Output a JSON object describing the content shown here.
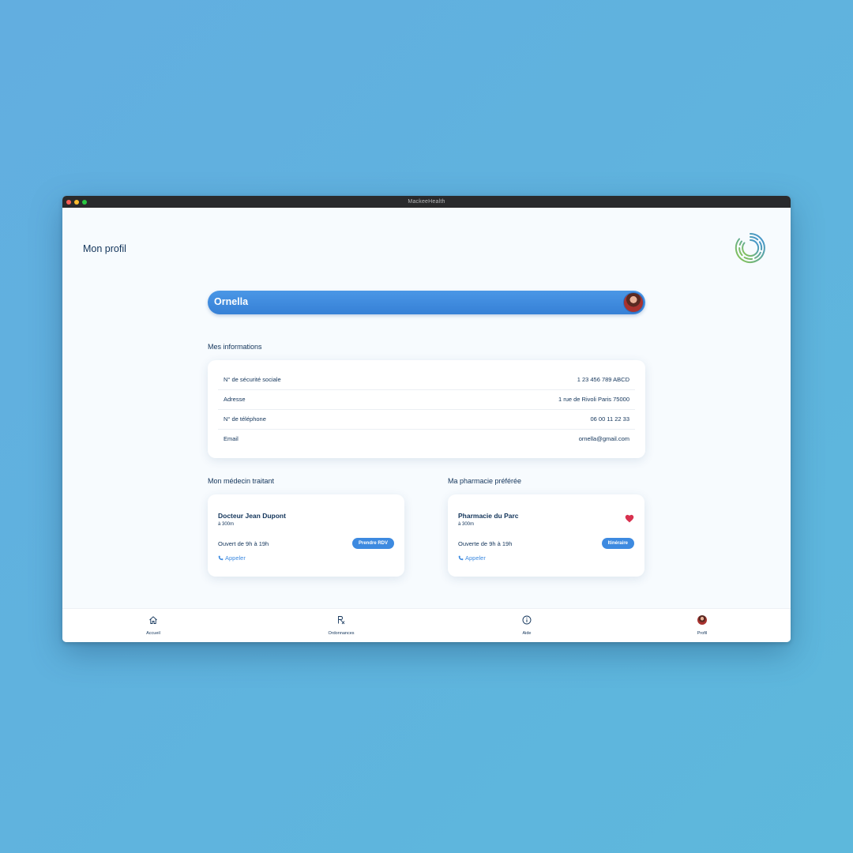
{
  "window": {
    "title": "MackeeHealth"
  },
  "page": {
    "title": "Mon profil"
  },
  "user": {
    "name": "Ornella"
  },
  "info": {
    "heading": "Mes informations",
    "rows": [
      {
        "label": "N° de sécurité sociale",
        "value": "1 23 456 789 ABCD"
      },
      {
        "label": "Adresse",
        "value": "1 rue de Rivoli Paris 75000"
      },
      {
        "label": "N° de téléphone",
        "value": "06 00 11 22 33"
      },
      {
        "label": "Email",
        "value": "ornella@gmail.com"
      }
    ]
  },
  "doctor": {
    "heading": "Mon médecin traitant",
    "name": "Docteur Jean Dupont",
    "distance": "à 300m",
    "hours": "Ouvert de 9h à 19h",
    "button": "Prendre RDV",
    "call": "Appeler"
  },
  "pharmacy": {
    "heading": "Ma pharmacie préférée",
    "name": "Pharmacie du Parc",
    "distance": "à 300m",
    "hours": "Ouverte de 9h à 19h",
    "button": "Itinéraire",
    "call": "Appeler",
    "favorite_color": "#d8314f"
  },
  "tabs": [
    {
      "label": "Accueil",
      "icon": "home-icon"
    },
    {
      "label": "Ordonnances",
      "icon": "rx-icon"
    },
    {
      "label": "Aide",
      "icon": "info-icon"
    },
    {
      "label": "Profil",
      "icon": "avatar"
    }
  ],
  "colors": {
    "accent": "#3d8ae0",
    "text": "#12345a",
    "background": "#5fb3df"
  }
}
